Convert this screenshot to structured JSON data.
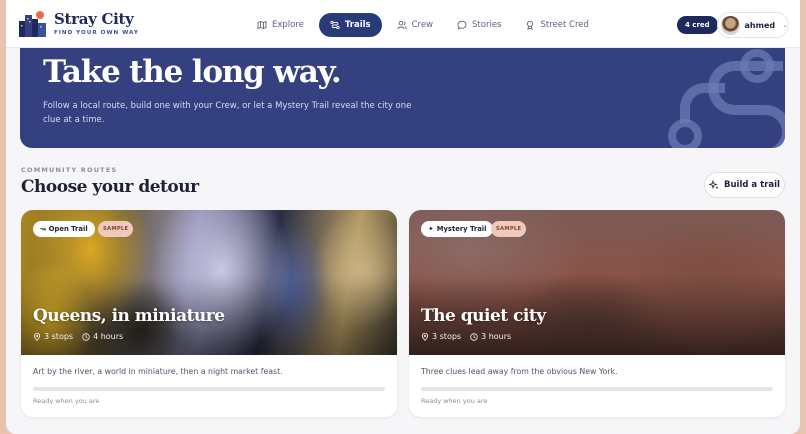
{
  "brand": {
    "name": "Stray City",
    "tagline": "FIND YOUR OWN WAY"
  },
  "nav": {
    "items": [
      {
        "label": "Explore",
        "icon": "map-icon",
        "active": false
      },
      {
        "label": "Trails",
        "icon": "route-icon",
        "active": true
      },
      {
        "label": "Crew",
        "icon": "people-icon",
        "active": false
      },
      {
        "label": "Stories",
        "icon": "chat-icon",
        "active": false
      },
      {
        "label": "Street Cred",
        "icon": "medal-icon",
        "active": false
      }
    ]
  },
  "header": {
    "cred_badge": "4 cred",
    "user_name": "ahmed",
    "user_chevron": "⌄"
  },
  "hero": {
    "title": "Take the long way.",
    "subtitle": "Follow a local route, build one with your Crew, or let a Mystery Trail reveal the city one clue at a time."
  },
  "section": {
    "eyebrow": "COMMUNITY ROUTES",
    "title": "Choose your detour",
    "build_button": "Build a trail"
  },
  "cards": [
    {
      "type_label": "Open Trail",
      "type_icon": "↝",
      "sample_label": "SAMPLE",
      "title": "Queens, in miniature",
      "stops": "3 stops",
      "duration": "4 hours",
      "description": "Art by the river, a world in miniature, then a night market feast.",
      "progress": 0,
      "status": "Ready when you are"
    },
    {
      "type_label": "Mystery Trail",
      "type_icon": "✦",
      "sample_label": "SAMPLE",
      "title": "The quiet city",
      "stops": "3 stops",
      "duration": "3 hours",
      "description": "Three clues lead away from the obvious New York.",
      "progress": 0,
      "status": "Ready when you are"
    }
  ],
  "colors": {
    "primary": "#34407f",
    "nav_active": "#283a78",
    "badge": "#1e2a5c",
    "sample_bg": "#f0c9bd",
    "page_bg": "#f6f6f8",
    "outer_bg": "#e8c3ad"
  }
}
